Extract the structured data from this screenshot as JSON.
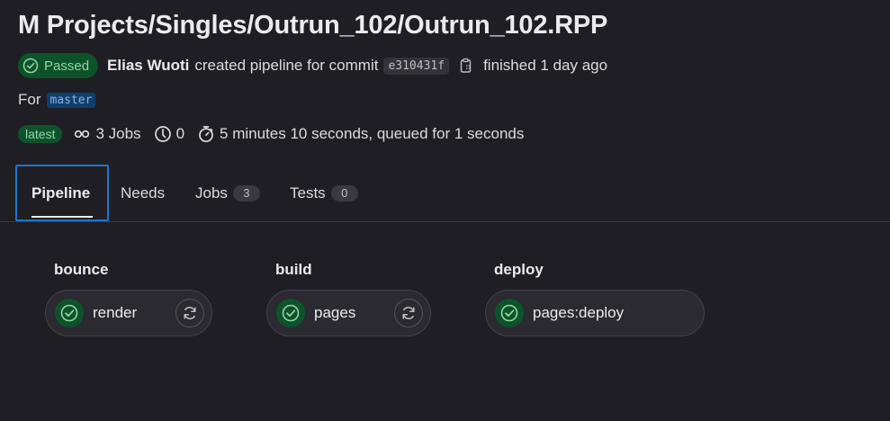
{
  "header": {
    "title": "M Projects/Singles/Outrun_102/Outrun_102.RPP",
    "status_label": "Passed",
    "author": "Elias Wuoti",
    "created_text": "created pipeline for commit",
    "commit_sha": "e310431f",
    "finished_text": "finished 1 day ago",
    "for_label": "For",
    "branch": "master"
  },
  "stats": {
    "latest_label": "latest",
    "jobs": "3 Jobs",
    "warnings": "0",
    "duration": "5 minutes 10 seconds, queued for 1 seconds"
  },
  "tabs": [
    {
      "label": "Pipeline",
      "active": true
    },
    {
      "label": "Needs"
    },
    {
      "label": "Jobs",
      "count": "3"
    },
    {
      "label": "Tests",
      "count": "0"
    }
  ],
  "stages": [
    {
      "name": "bounce",
      "jobs": [
        {
          "name": "render",
          "retry": true
        }
      ]
    },
    {
      "name": "build",
      "jobs": [
        {
          "name": "pages",
          "retry": true
        }
      ]
    },
    {
      "name": "deploy",
      "jobs": [
        {
          "name": "pages:deploy",
          "retry": false
        }
      ]
    }
  ],
  "colors": {
    "background": "#1f1e24",
    "success_bg": "#0d532a",
    "success_fg": "#91d4a8",
    "focus_border": "#1f75cb"
  }
}
